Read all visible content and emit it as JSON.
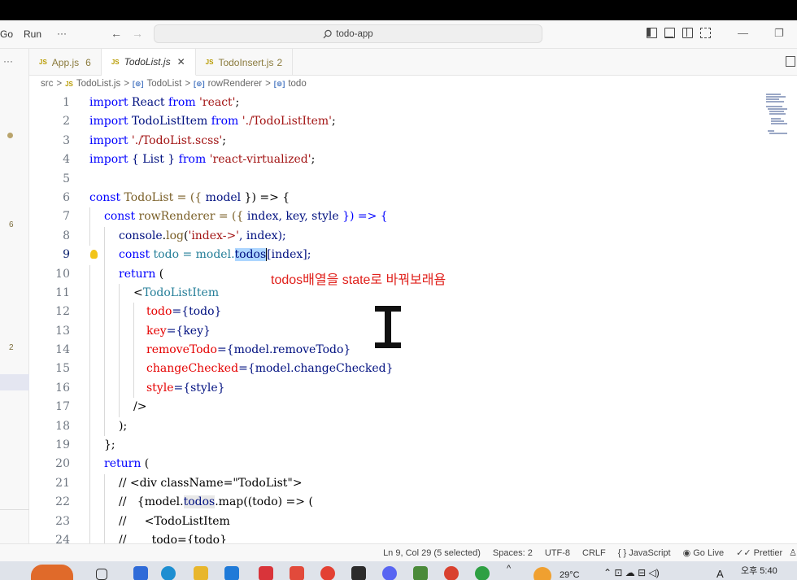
{
  "menu": {
    "go": "Go",
    "run": "Run",
    "more": "···"
  },
  "nav": {
    "back": "←",
    "forward": "→"
  },
  "search": {
    "icon_name": "search-icon",
    "text": "todo-app"
  },
  "window_controls": {
    "minimize": "—",
    "restore": "❐"
  },
  "sidebar": {
    "more": "···",
    "badge1": "6",
    "badge2": "2"
  },
  "tabs": [
    {
      "icon": "JS",
      "label": "App.js",
      "count": "6"
    },
    {
      "icon": "JS",
      "label": "TodoList.js",
      "close": "✕"
    },
    {
      "icon": "JS",
      "label": "TodoInsert.js",
      "count": "2"
    }
  ],
  "breadcrumb": {
    "src": "src",
    "sep": ">",
    "file": "TodoList.js",
    "sym_icon": "[⊚]",
    "c1": "TodoList",
    "c2": "rowRenderer",
    "c3": "todo"
  },
  "code_lines": {
    "n1": "1",
    "n2": "2",
    "n3": "3",
    "n4": "4",
    "n5": "5",
    "n6": "6",
    "n7": "7",
    "n8": "8",
    "n9": "9",
    "n10": "10",
    "n11": "11",
    "n12": "12",
    "n13": "13",
    "n14": "14",
    "n15": "15",
    "n16": "16",
    "n17": "17",
    "n18": "18",
    "n19": "19",
    "n20": "20",
    "n21": "21",
    "n22": "22",
    "n23": "23",
    "n24": "24"
  },
  "code": {
    "import": "import",
    "from": "from",
    "l1a": " React ",
    "l1s": "'react'",
    "semi": ";",
    "l2a": " TodoListItem ",
    "l2s": "'./TodoListItem'",
    "l3s": " './TodoList.scss'",
    "l4a": " { List } ",
    "l4s": "'react-virtualized'",
    "const": "const",
    "l6a": " TodoList = ({ ",
    "l6b": "model",
    "l6c": " }) => {",
    "l7a": " rowRenderer = ({ ",
    "l7b": "index, key, style",
    "l7c": " }) => {",
    "l8a": "console",
    "l8b": ".",
    "l8c": "log",
    "l8d": "(",
    "l8s": "'index->'",
    "l8e": ", index);",
    "l9a": " todo = model.",
    "l9sel": "todos",
    "l9b": "[index];",
    "return": "return",
    "paren": " (",
    "l11tag": "TodoListItem",
    "lt": "<",
    "l12a": "todo",
    "l12b": "={todo}",
    "l13a": "key",
    "l13b": "={key}",
    "l14a": "removeTodo",
    "l14b": "={model.removeTodo}",
    "l15a": "changeChecked",
    "l15b": "={model.changeChecked}",
    "l16a": "style",
    "l16b": "={style}",
    "l17": "/>",
    "l18": ");",
    "l19": "};",
    "l21": "// <div className=\"TodoList\">",
    "l22a": "//   {model.",
    "l22b": "todos",
    "l22c": ".map((todo) => (",
    "l23": "//     <TodoListItem",
    "l24": "//       todo={todo}"
  },
  "annotation": "todos배열을 state로 바꿔보래욤",
  "status": {
    "position": "Ln 9, Col 29 (5 selected)",
    "spaces": "Spaces: 2",
    "encoding": "UTF-8",
    "eol": "CRLF",
    "language": "{ } JavaScript",
    "golive": "Go Live",
    "prettier": "Prettier"
  },
  "taskbar": {
    "weather": "29°C",
    "time": "오후 5:40",
    "ime": "A"
  }
}
